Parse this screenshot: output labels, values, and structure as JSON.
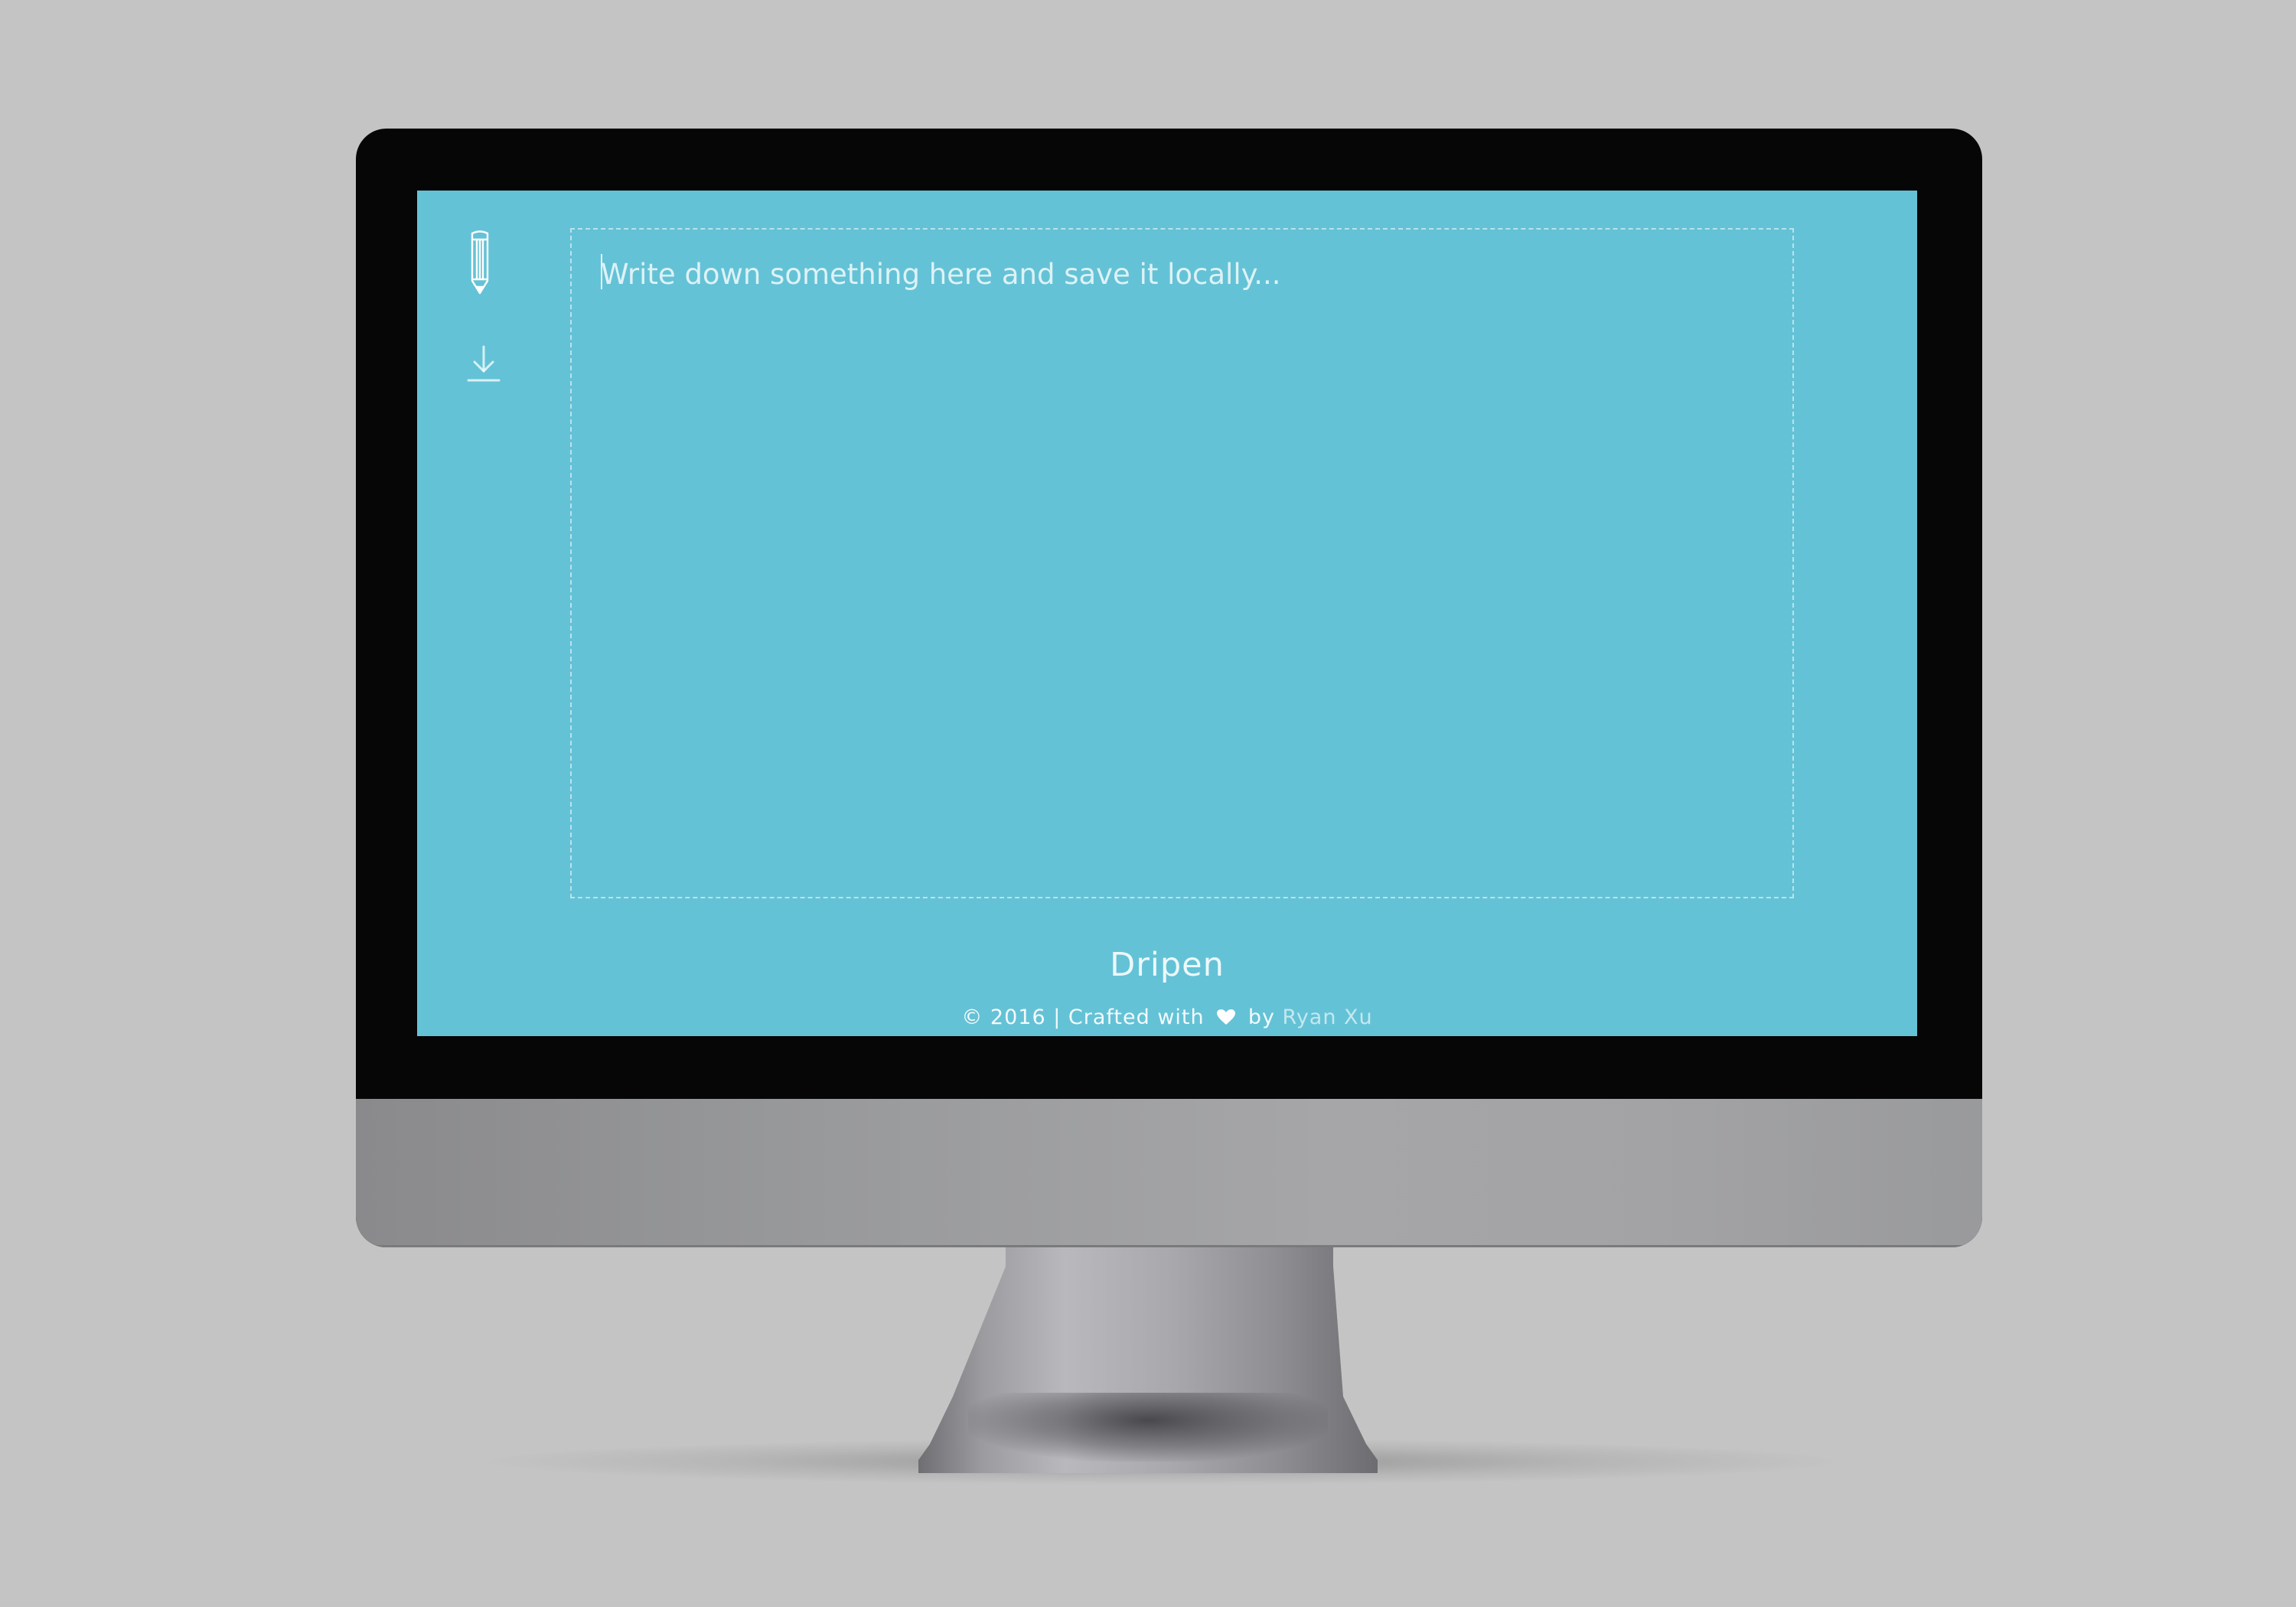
{
  "app": {
    "name": "Dripen",
    "accent_color": "#64c2d6"
  },
  "toolbar": {
    "items": [
      {
        "icon": "pencil-icon"
      },
      {
        "icon": "download-icon"
      }
    ]
  },
  "editor": {
    "placeholder": "Write down something here and save it locally...",
    "value": ""
  },
  "footer": {
    "copyright": "© 2016 | Crafted with",
    "heart_icon": "heart-icon",
    "by": "by",
    "author": "Ryan Xu"
  }
}
